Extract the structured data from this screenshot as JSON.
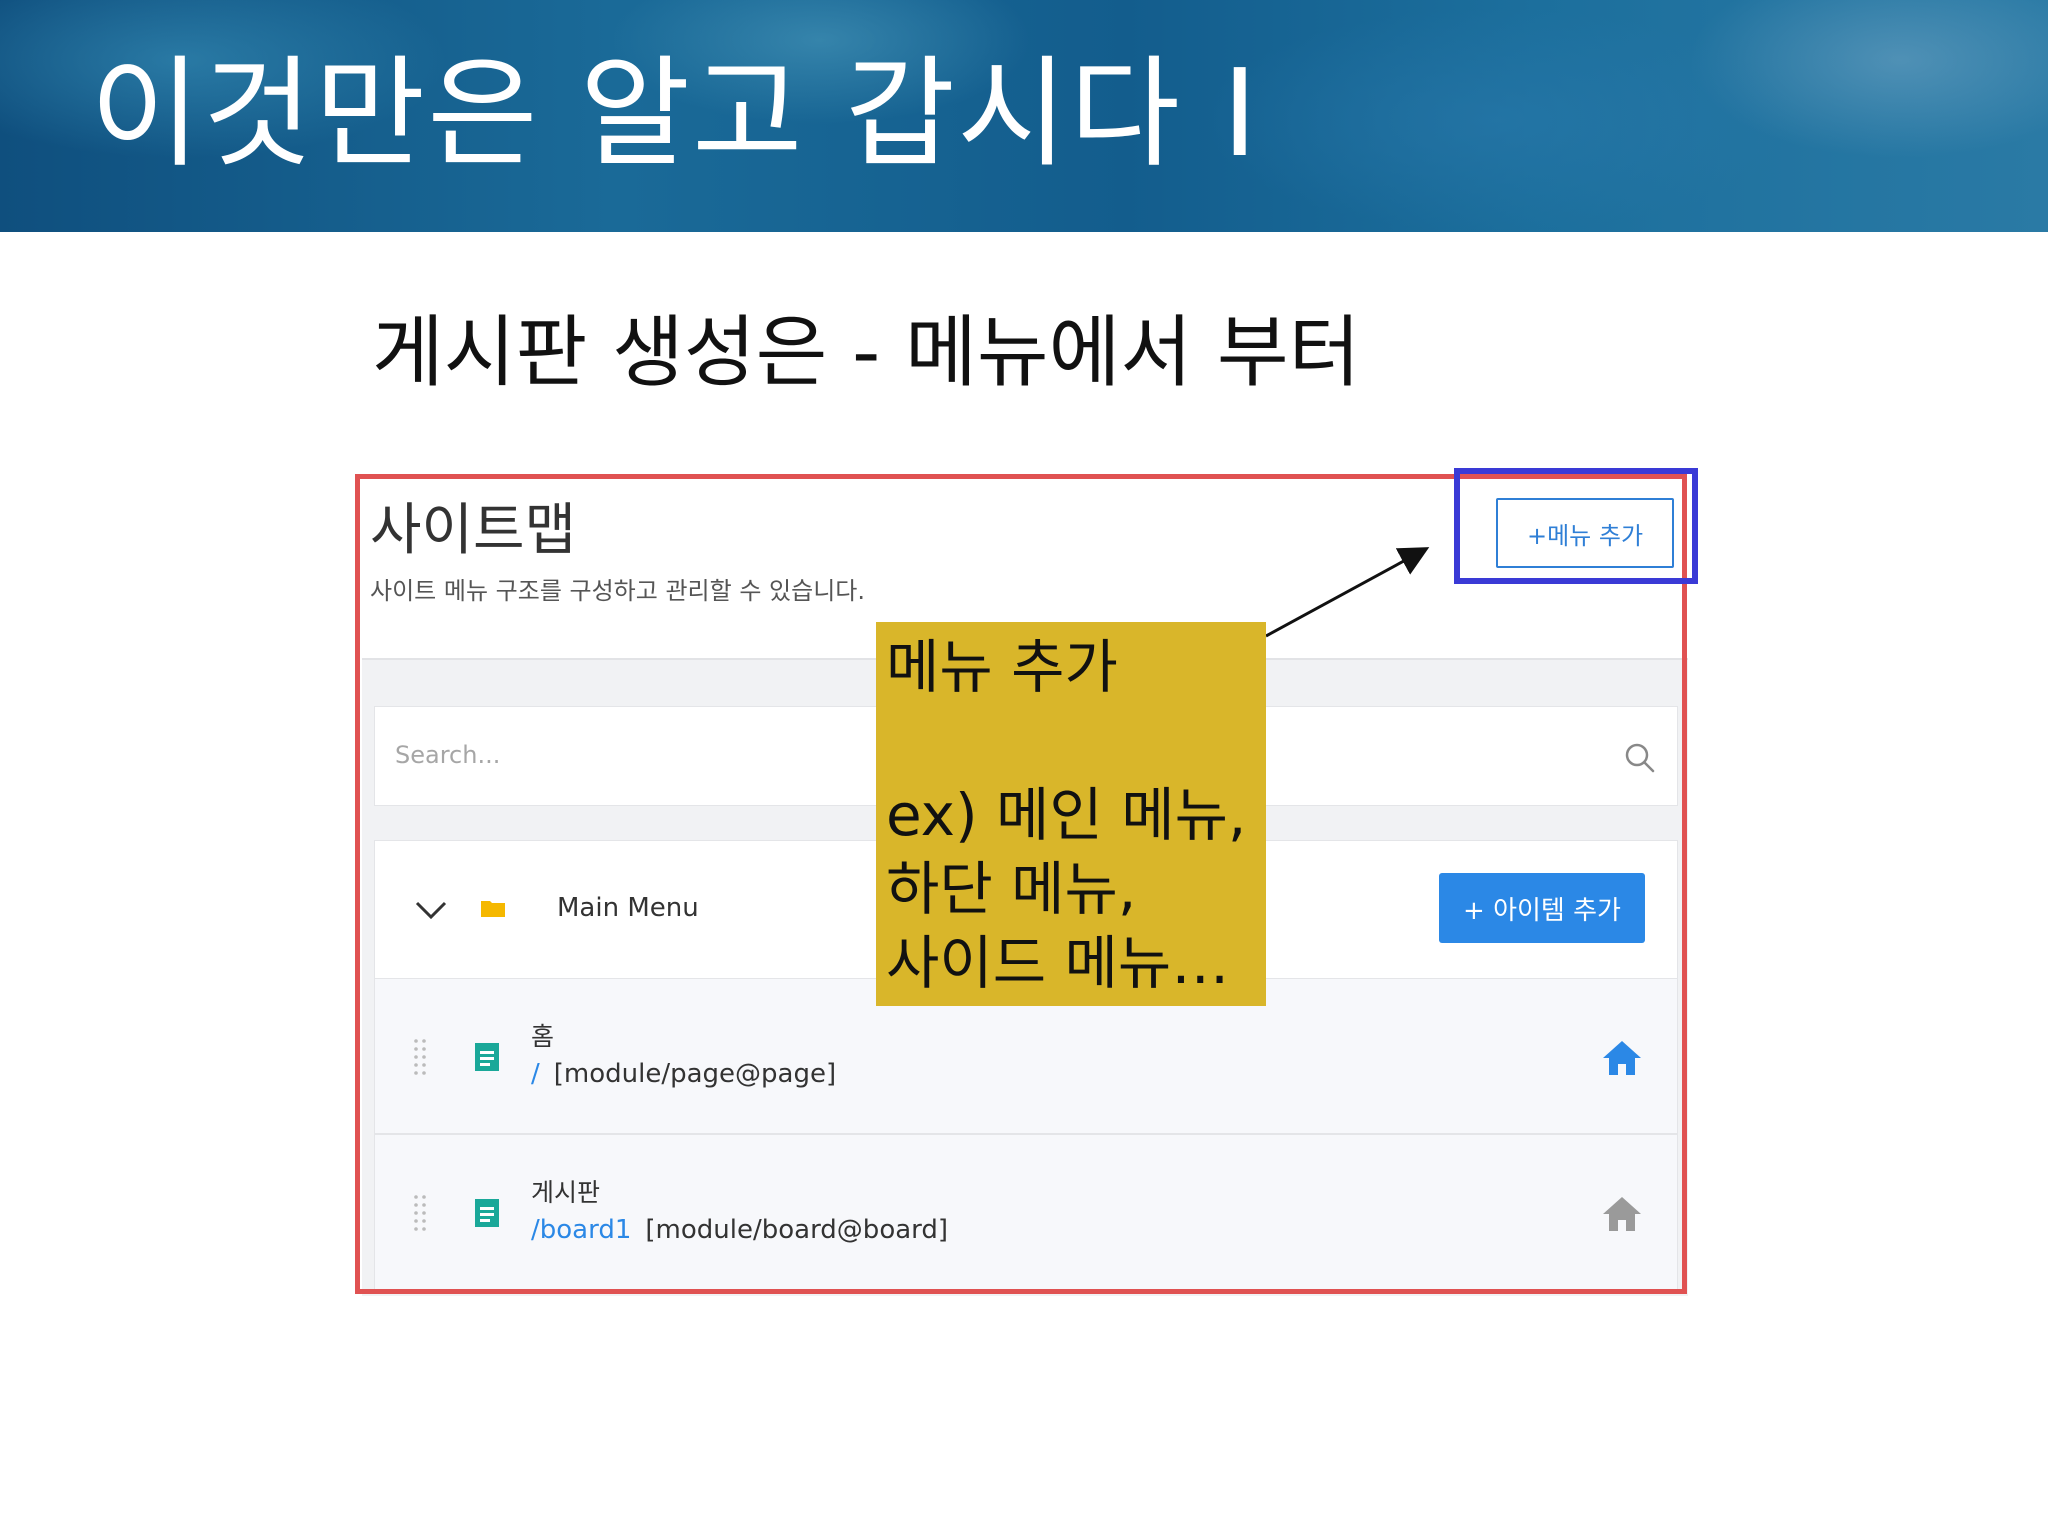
{
  "slide": {
    "title": "이것만은 알고 갑시다 I",
    "subtitle": "게시판 생성은 - 메뉴에서 부터"
  },
  "screenshot": {
    "header": {
      "title": "사이트맵",
      "description": "사이트 메뉴 구조를 구성하고 관리할 수 있습니다.",
      "add_menu_label": "+메뉴 추가"
    },
    "search": {
      "placeholder": "Search..."
    },
    "main_menu": {
      "label": "Main Menu",
      "add_item_label": "+ 아이템 추가"
    },
    "items": [
      {
        "name": "홈",
        "link": "/",
        "module": "[module/page@page]",
        "home": true
      },
      {
        "name": "게시판",
        "link": "/board1",
        "module": "[module/board@board]",
        "home": false
      }
    ]
  },
  "callout": {
    "title": "메뉴 추가",
    "lines": [
      "ex) 메인 메뉴,",
      "하단 메뉴,",
      "사이드 메뉴…"
    ]
  },
  "colors": {
    "highlight_frame": "#e05252",
    "button_frame": "#3a3ad6",
    "callout_bg": "#d9b62a",
    "accent_blue": "#2b88e6"
  }
}
